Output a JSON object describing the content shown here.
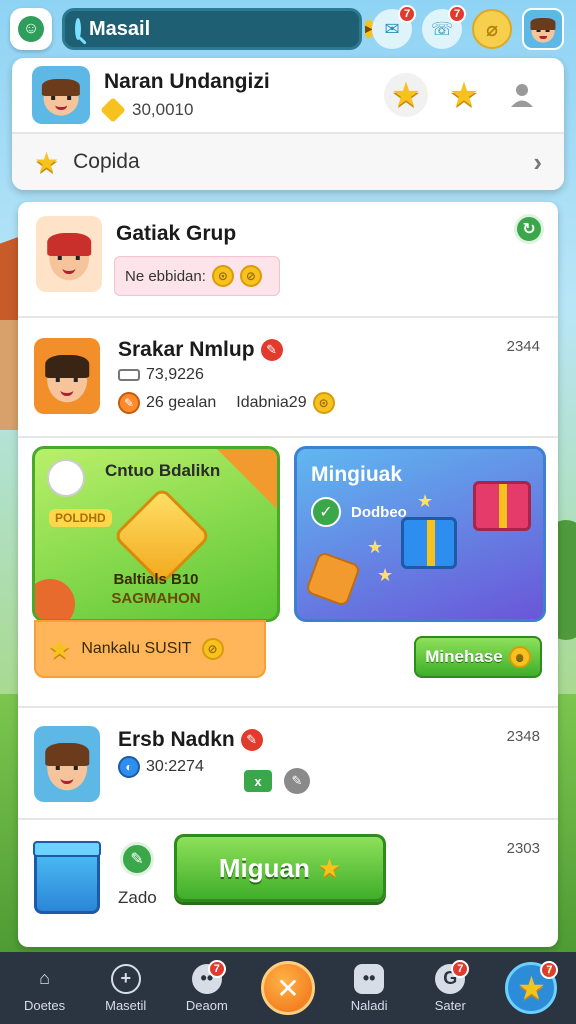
{
  "search": {
    "placeholder": "Masail"
  },
  "top_icons": [
    {
      "name": "chat-icon",
      "badge": "7"
    },
    {
      "name": "chat-icon",
      "badge": "7"
    },
    {
      "name": "coin-icon",
      "badge": ""
    }
  ],
  "profile": {
    "name": "Naran Undangizi",
    "coins": "30,0010",
    "star_count": 3
  },
  "copida": {
    "label": "Copida"
  },
  "posts": [
    {
      "title": "Gatiak Grup",
      "pill_text": "Ne ebbidan:"
    },
    {
      "title": "Srakar Nmlup",
      "time": "2344",
      "stat1": "73,9226",
      "stat2": "26 gealan",
      "stat3": "Idabnia29"
    },
    {
      "title": "Ersb Nadkn",
      "time": "2348",
      "stat1": "30:2274",
      "tag": "x"
    },
    {
      "time": "2303",
      "sub": "Zado"
    }
  ],
  "promo": {
    "green_title": "Cntuo Bdalikn",
    "green_tag": "POLDHD",
    "green_line1": "Baltials B10",
    "green_line2": "SAGMAHON",
    "orange_label": "Nankalu SUSIT",
    "blue_title": "Mingiuak",
    "blue_sub": "Dodbeo",
    "blue_button": "Minehase"
  },
  "big_button": {
    "label": "Miguan"
  },
  "bottom_nav": [
    {
      "label": "Doetes",
      "icon": "home-icon",
      "badge": ""
    },
    {
      "label": "Masetil",
      "icon": "compass-icon",
      "badge": ""
    },
    {
      "label": "Deaom",
      "icon": "chat-bubble-icon",
      "badge": "7"
    },
    {
      "label": "",
      "icon": "center-action-icon",
      "badge": ""
    },
    {
      "label": "Naladi",
      "icon": "gamepad-icon",
      "badge": ""
    },
    {
      "label": "Sater",
      "icon": "gear-icon",
      "badge": "7"
    },
    {
      "label": "",
      "icon": "star-icon",
      "badge": "7"
    }
  ],
  "colors": {
    "accent_green": "#3fae2a",
    "accent_orange": "#ef6d14",
    "nav_bg": "#2b3542",
    "badge_red": "#e23b2e",
    "gold": "#f7c21e"
  }
}
